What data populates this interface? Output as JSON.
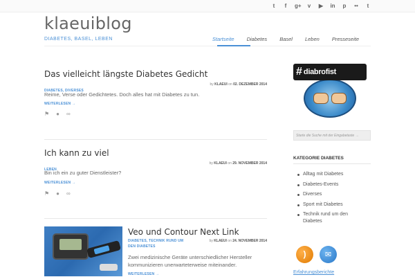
{
  "social": {
    "icons": [
      "twitter-icon",
      "facebook-icon",
      "googleplus-icon",
      "vimeo-icon",
      "youtube-icon",
      "linkedin-icon",
      "pinterest-icon",
      "flickr-icon",
      "tumblr-icon"
    ],
    "glyphs": [
      "t",
      "f",
      "g+",
      "v",
      "▶",
      "in",
      "p",
      "••",
      "t"
    ]
  },
  "site": {
    "title": "klaeuiblog",
    "tagline": "DIABETES, BASEL, LEBEN"
  },
  "nav": {
    "items": [
      "Startseite",
      "Diabetes",
      "Basel",
      "Leben",
      "Presseseite"
    ],
    "active": "Startseite"
  },
  "posts": [
    {
      "title": "Das vielleicht längste Diabetes Gedicht",
      "categories": "DIABETES, DIVERSES",
      "by": "by",
      "author": "KLAEUI",
      "on": "on",
      "date": "02. DEZEMBER 2014",
      "excerpt": "Reime, Verse oder Gedichtetes. Doch alles hat mit Diabetes zu tun.",
      "readmore": "WEITERLESEN →"
    },
    {
      "title": "Ich kann zu viel",
      "categories": "LEBEN",
      "by": "by",
      "author": "KLAEUI",
      "on": "on",
      "date": "29. NOVEMBER 2014",
      "excerpt": "Bin ich ein zu guter Dienstleister?",
      "readmore": "WEITERLESEN →"
    },
    {
      "title": "Veo und Contour Next Link",
      "categories_line1": "DIABETES, TECHNIK RUND UM",
      "categories_line2": "DEN DIABETES",
      "by": "by",
      "author": "KLAEUI",
      "on": "on",
      "date": "24. NOVEMBER 2014",
      "excerpt": "Zwei medizinische Geräte unterschiedlicher Hersteller kommunizieren unerwarteterweise miteinander.",
      "readmore": "WEITERLESEN →"
    }
  ],
  "post_icons": [
    "tag-icon",
    "comments-icon",
    "link-icon"
  ],
  "sidebar": {
    "badge_text": "diabrofist",
    "badge_hash": "#",
    "search_placeholder": "Starte die Suche mit der Eingabetaste →",
    "category_title": "KATEGORIE DIABETES",
    "categories": [
      "Alltag mit Diabetes",
      "Diabetes-Events",
      "Diverses",
      "Sport mit Diabetes",
      "Technik rund um den Diabetes"
    ],
    "link": "Erfahrungsberichte"
  },
  "colors": {
    "accent": "#4a90d6",
    "text": "#555555"
  }
}
